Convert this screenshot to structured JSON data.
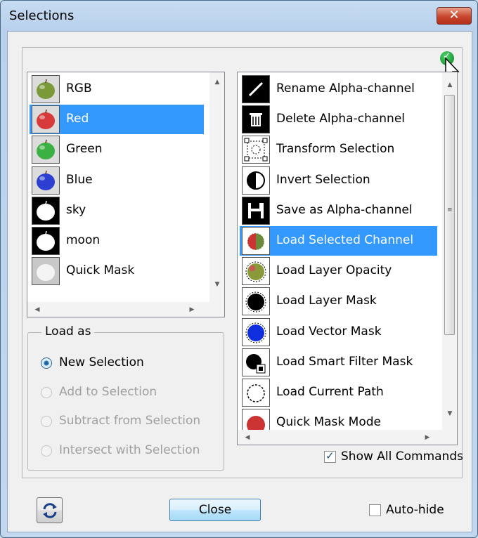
{
  "window": {
    "title": "Selections",
    "close_glyph": "✕"
  },
  "channels": [
    {
      "label": "RGB",
      "icon": "apple-rgb-icon"
    },
    {
      "label": "Red",
      "icon": "apple-red-icon",
      "selected": true
    },
    {
      "label": "Green",
      "icon": "apple-green-icon"
    },
    {
      "label": "Blue",
      "icon": "apple-blue-icon"
    },
    {
      "label": "sky",
      "icon": "apple-mask-sky-icon"
    },
    {
      "label": "moon",
      "icon": "apple-mask-moon-icon"
    },
    {
      "label": "Quick Mask",
      "icon": "quick-mask-icon"
    }
  ],
  "load_as": {
    "legend": "Load as",
    "options": [
      {
        "label": "New Selection",
        "checked": true,
        "enabled": true
      },
      {
        "label": "Add to Selection",
        "checked": false,
        "enabled": false
      },
      {
        "label": "Subtract from Selection",
        "checked": false,
        "enabled": false
      },
      {
        "label": "Intersect with Selection",
        "checked": false,
        "enabled": false
      }
    ]
  },
  "commands": [
    {
      "label": "Rename Alpha-channel",
      "icon": "pencil-icon"
    },
    {
      "label": "Delete Alpha-channel",
      "icon": "trash-icon"
    },
    {
      "label": "Transform Selection",
      "icon": "transform-icon"
    },
    {
      "label": "Invert Selection",
      "icon": "invert-icon"
    },
    {
      "label": "Save as Alpha-channel",
      "icon": "floppy-disk-icon"
    },
    {
      "label": "Load Selected Channel",
      "icon": "load-channel-icon",
      "selected": true
    },
    {
      "label": "Load Layer Opacity",
      "icon": "layer-opacity-icon"
    },
    {
      "label": "Load Layer Mask",
      "icon": "layer-mask-icon"
    },
    {
      "label": "Load Vector Mask",
      "icon": "vector-mask-icon"
    },
    {
      "label": "Load Smart Filter Mask",
      "icon": "smart-filter-mask-icon"
    },
    {
      "label": "Load Current Path",
      "icon": "current-path-icon"
    },
    {
      "label": "Quick Mask Mode",
      "icon": "quick-mask-mode-icon"
    }
  ],
  "show_all_commands": {
    "label": "Show All Commands",
    "checked": true
  },
  "footer": {
    "close_label": "Close",
    "autohide_label": "Auto-hide",
    "autohide_checked": false
  },
  "colors": {
    "selection": "#3399ff",
    "confirm": "#1f9a3a",
    "title_close": "#c9452d"
  }
}
